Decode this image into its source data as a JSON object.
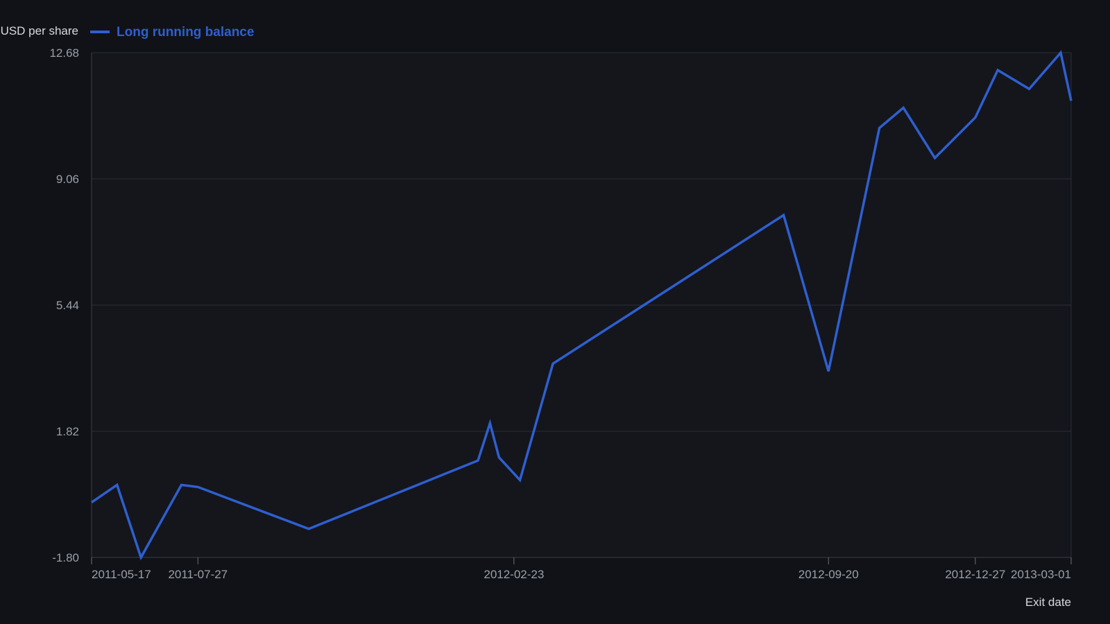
{
  "chart_data": {
    "type": "line",
    "xlabel": "Exit date",
    "ylabel": "USD per share",
    "y_axis": {
      "ticks": [
        -1.8,
        1.82,
        5.44,
        9.06,
        12.68
      ],
      "tick_labels": [
        "-1.80",
        "1.82",
        "5.44",
        "9.06",
        "12.68"
      ],
      "ylim": [
        -1.8,
        12.68
      ]
    },
    "x_axis": {
      "ticks": [
        "2011-05-17",
        "2011-07-27",
        "2012-02-23",
        "2012-09-20",
        "2012-12-27",
        "2013-03-01"
      ],
      "xlim": [
        "2011-05-17",
        "2013-03-01"
      ]
    },
    "grid": true,
    "legend_position": "top-left",
    "series": [
      {
        "name": "Long running balance",
        "color": "#2f5fd0",
        "points": [
          {
            "x": "2011-05-17",
            "y": -0.22
          },
          {
            "x": "2011-06-03",
            "y": 0.28
          },
          {
            "x": "2011-06-19",
            "y": -1.8
          },
          {
            "x": "2011-07-16",
            "y": 0.28
          },
          {
            "x": "2011-07-27",
            "y": 0.22
          },
          {
            "x": "2011-10-09",
            "y": -0.98
          },
          {
            "x": "2012-01-30",
            "y": 0.98
          },
          {
            "x": "2012-02-07",
            "y": 2.05
          },
          {
            "x": "2012-02-13",
            "y": 1.07
          },
          {
            "x": "2012-02-27",
            "y": 0.42
          },
          {
            "x": "2012-03-20",
            "y": 3.76
          },
          {
            "x": "2012-08-21",
            "y": 8.02
          },
          {
            "x": "2012-09-20",
            "y": 3.54
          },
          {
            "x": "2012-10-24",
            "y": 10.52
          },
          {
            "x": "2012-11-09",
            "y": 11.1
          },
          {
            "x": "2012-11-30",
            "y": 9.66
          },
          {
            "x": "2012-12-27",
            "y": 10.82
          },
          {
            "x": "2013-01-11",
            "y": 12.18
          },
          {
            "x": "2013-02-01",
            "y": 11.64
          },
          {
            "x": "2013-02-22",
            "y": 12.68
          },
          {
            "x": "2013-03-01",
            "y": 11.3
          }
        ]
      }
    ]
  }
}
